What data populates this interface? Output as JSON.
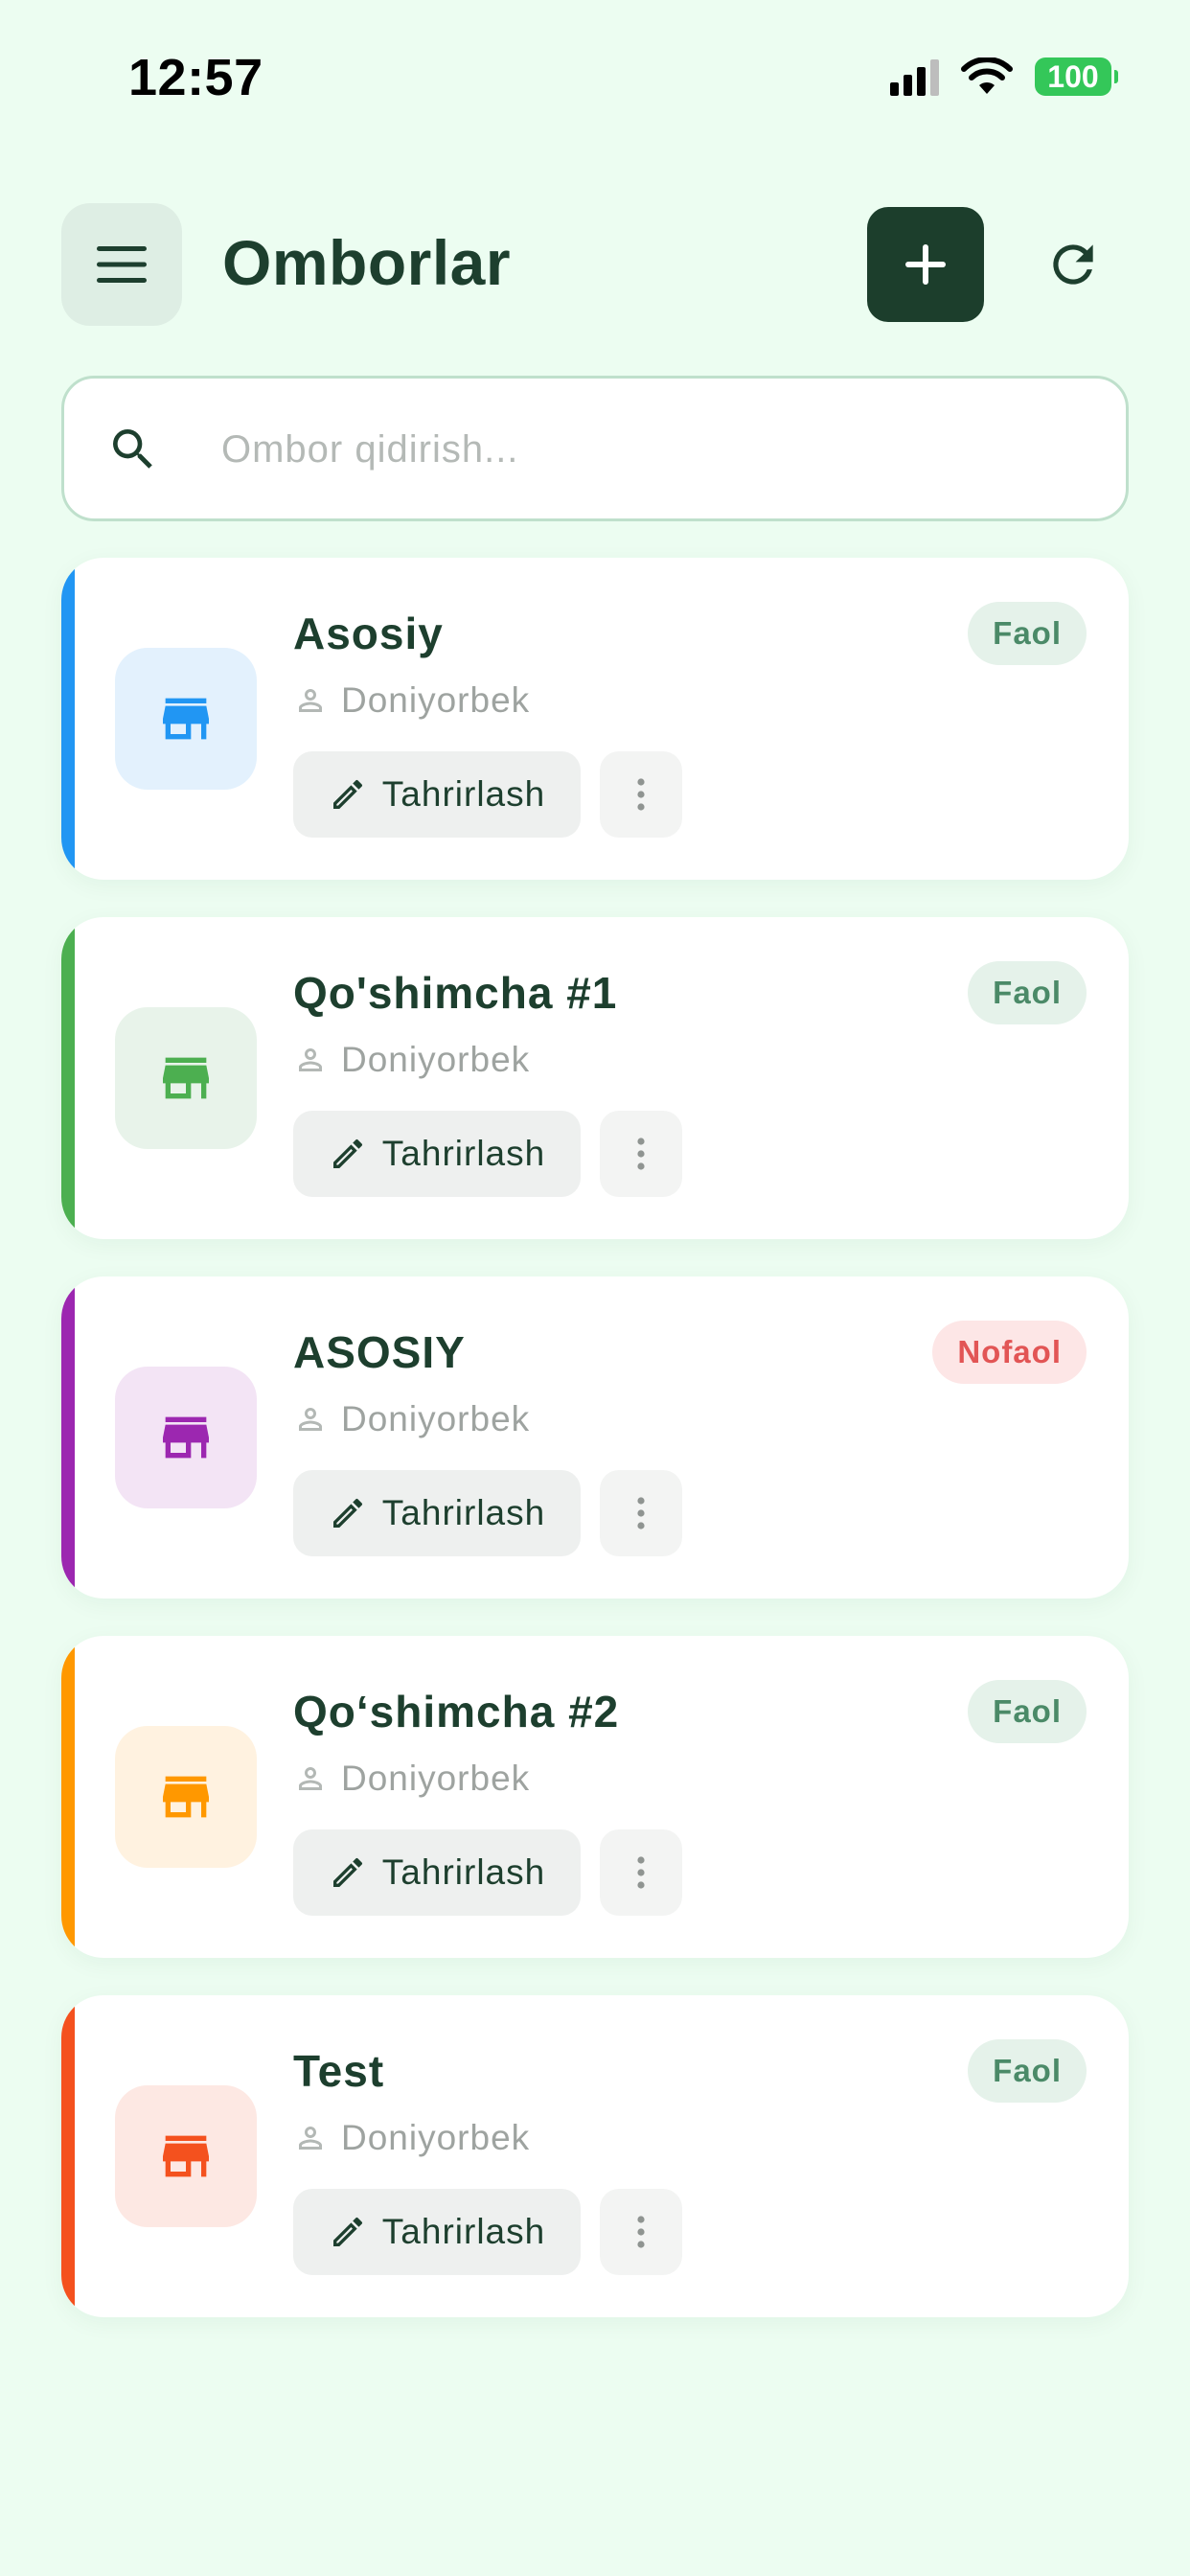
{
  "status_bar": {
    "time": "12:57",
    "battery": "100"
  },
  "header": {
    "title": "Omborlar"
  },
  "search": {
    "placeholder": "Ombor qidirish..."
  },
  "warehouses": [
    {
      "name": "Asosiy",
      "owner": "Doniyorbek",
      "status": "Faol",
      "edit_label": "Tahrirlash",
      "accent_color": "#2196f3",
      "icon_bg": "#e3f1fd"
    },
    {
      "name": "Qo'shimcha #1",
      "owner": "Doniyorbek",
      "status": "Faol",
      "edit_label": "Tahrirlash",
      "accent_color": "#4caf50",
      "icon_bg": "#e8f3ea"
    },
    {
      "name": "ASOSIY",
      "owner": "Doniyorbek",
      "status": "Nofaol",
      "edit_label": "Tahrirlash",
      "accent_color": "#9c27b0",
      "icon_bg": "#f3e4f5"
    },
    {
      "name": "Qoʻshimcha #2",
      "owner": "Doniyorbek",
      "status": "Faol",
      "edit_label": "Tahrirlash",
      "accent_color": "#ff9800",
      "icon_bg": "#fff2e0"
    },
    {
      "name": "Test",
      "owner": "Doniyorbek",
      "status": "Faol",
      "edit_label": "Tahrirlash",
      "accent_color": "#f4511e",
      "icon_bg": "#fde8e3"
    }
  ],
  "icons": {
    "menu": "menu-icon",
    "add": "plus-icon",
    "refresh": "refresh-icon",
    "search": "search-icon",
    "store": "store-icon",
    "person": "person-icon",
    "edit": "pencil-icon",
    "more": "more-vertical-icon"
  }
}
